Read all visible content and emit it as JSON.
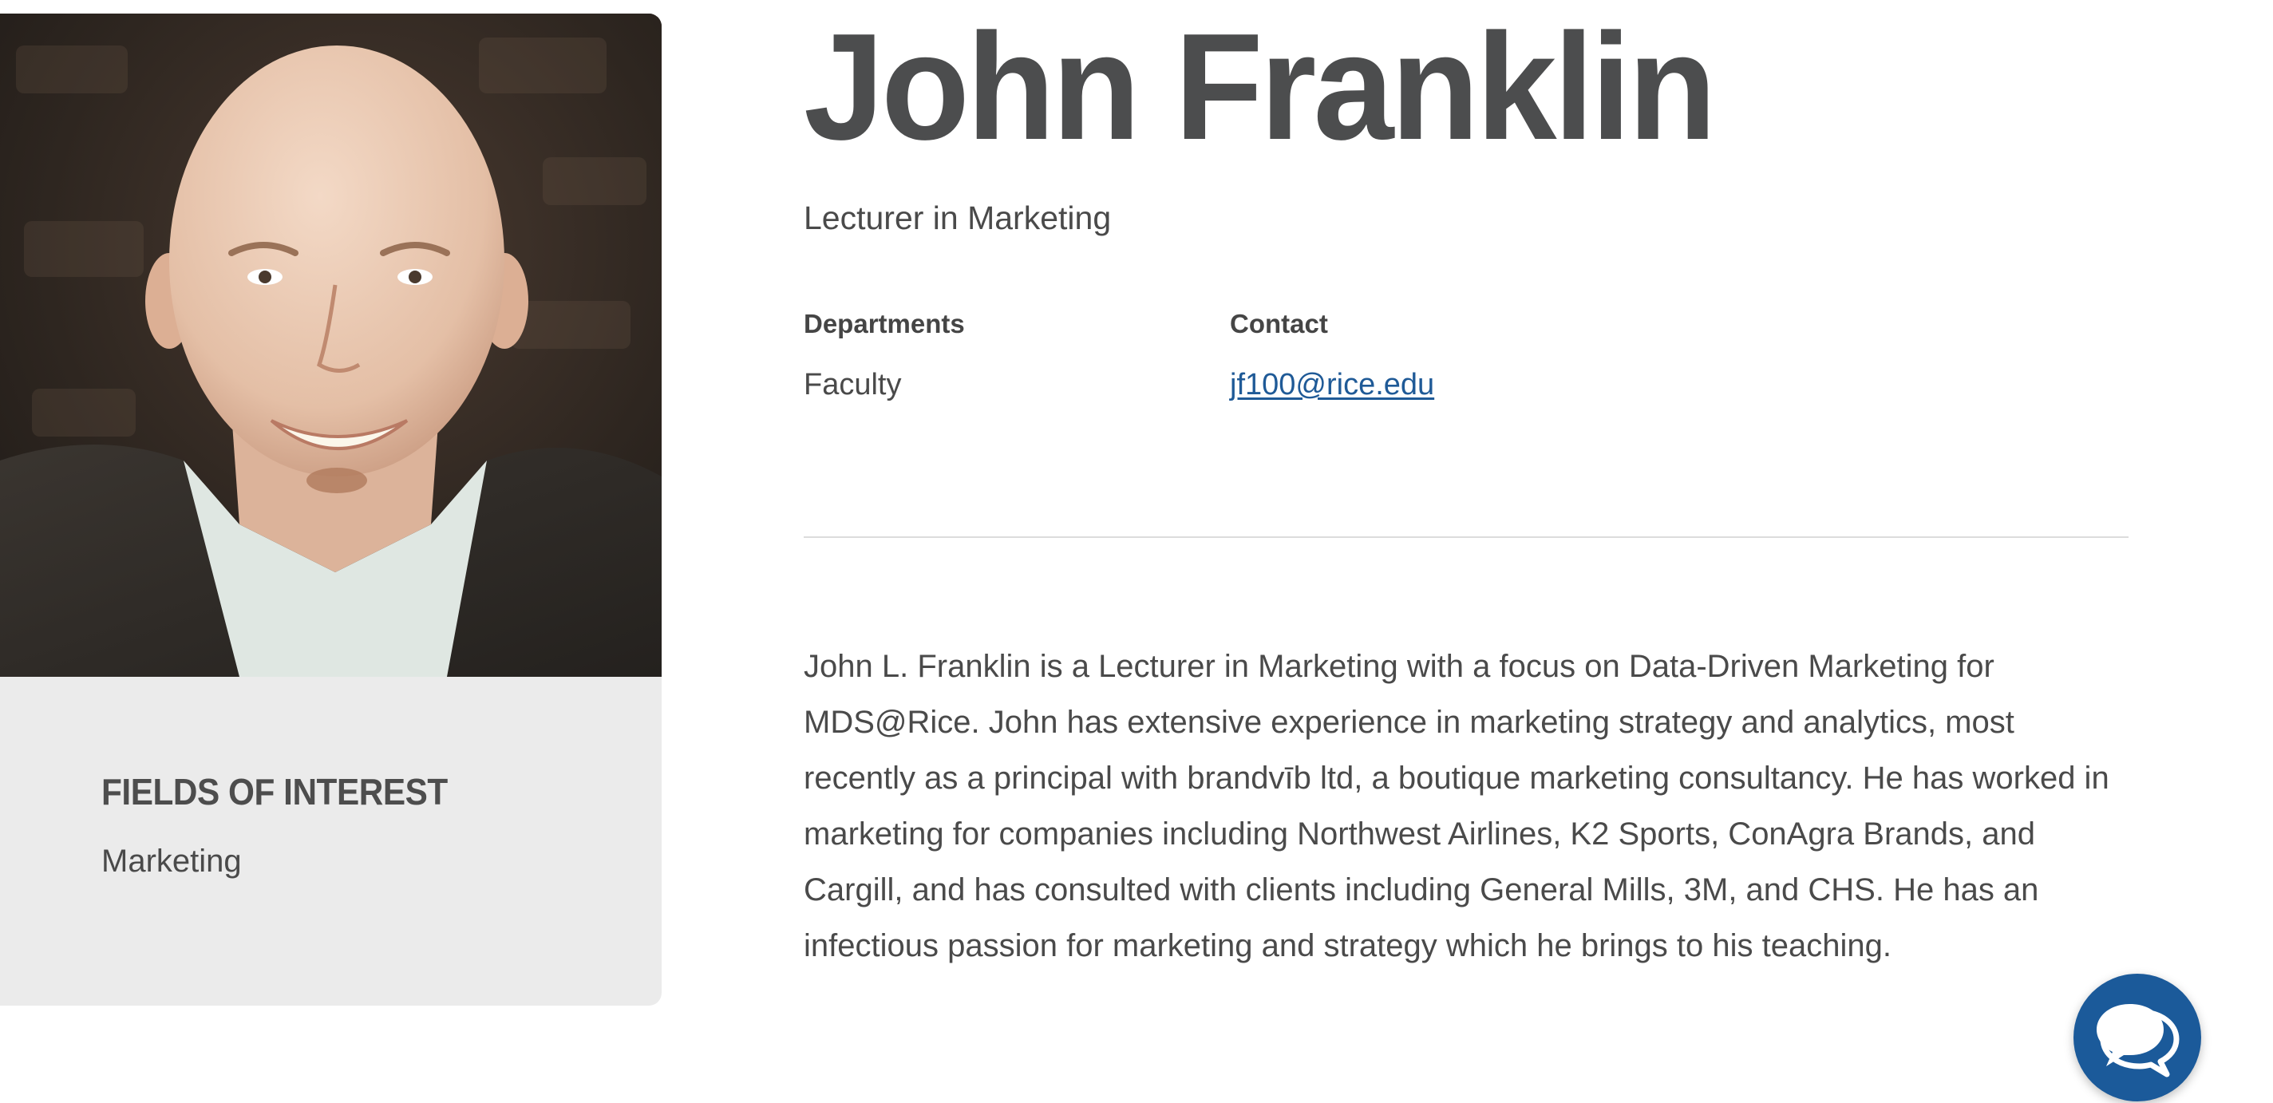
{
  "profile": {
    "name": "John Franklin",
    "title": "Lecturer in Marketing",
    "departments_label": "Departments",
    "departments_value": "Faculty",
    "contact_label": "Contact",
    "contact_email": "jf100@rice.edu",
    "bio": "John L. Franklin is a Lecturer in Marketing with a focus on Data-Driven Marketing for MDS@Rice. John has extensive experience in marketing strategy and analytics, most recently as a principal with brandvīb ltd, a boutique marketing consultancy. He has worked in marketing for companies including Northwest Airlines, K2 Sports, ConAgra Brands, and Cargill, and has consulted with clients including General Mills, 3M, and CHS. He has an infectious passion for marketing and strategy which he brings to his teaching."
  },
  "sidebar": {
    "interests_heading": "FIELDS OF INTEREST",
    "interests": [
      "Marketing"
    ]
  },
  "chat": {
    "icon": "chat-bubbles-icon"
  },
  "colors": {
    "link": "#1f5a97",
    "chat_bg": "#1b5a9a",
    "card_bg": "#ebebeb",
    "text": "#4a4a4a"
  }
}
